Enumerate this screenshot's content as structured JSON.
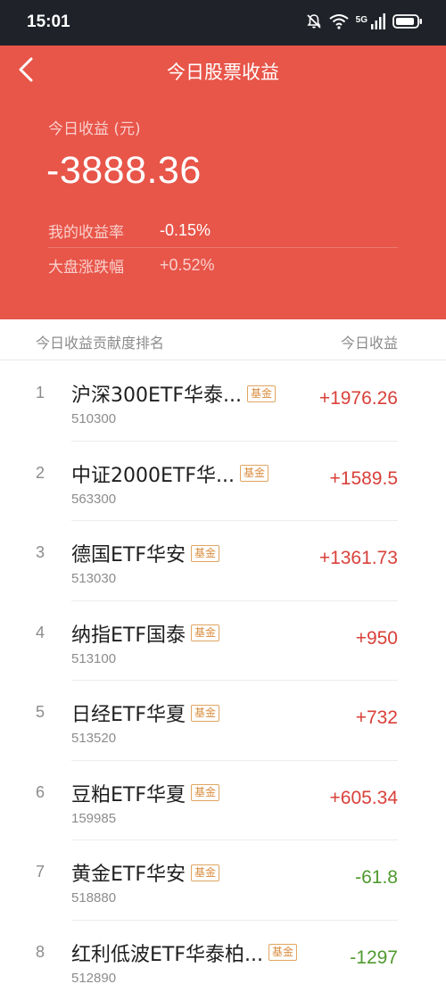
{
  "status_bar": {
    "time": "15:01",
    "network": "5G",
    "icons": [
      "mute-bell-icon",
      "wifi-icon",
      "signal-icon",
      "battery-icon"
    ]
  },
  "nav": {
    "title": "今日股票收益",
    "back_icon": "chevron-left-icon"
  },
  "summary": {
    "label": "今日收益 (元)",
    "value": "-3888.36",
    "rate_label": "我的收益率",
    "rate_value": "-0.15%",
    "market_label": "大盘涨跌幅",
    "market_value": "+0.52%"
  },
  "list_header": {
    "left": "今日收益贡献度排名",
    "right": "今日收益"
  },
  "colors": {
    "header_bg": "#e85549",
    "gain": "#d9403a",
    "loss": "#4f9a2e",
    "badge": "#d98c3e"
  },
  "items": [
    {
      "rank": "1",
      "name": "沪深300ETF华泰...",
      "badge": "基金",
      "code": "510300",
      "value": "+1976.26",
      "direction": "up"
    },
    {
      "rank": "2",
      "name": "中证2000ETF华...",
      "badge": "基金",
      "code": "563300",
      "value": "+1589.5",
      "direction": "up"
    },
    {
      "rank": "3",
      "name": "德国ETF华安",
      "badge": "基金",
      "code": "513030",
      "value": "+1361.73",
      "direction": "up"
    },
    {
      "rank": "4",
      "name": "纳指ETF国泰",
      "badge": "基金",
      "code": "513100",
      "value": "+950",
      "direction": "up"
    },
    {
      "rank": "5",
      "name": "日经ETF华夏",
      "badge": "基金",
      "code": "513520",
      "value": "+732",
      "direction": "up"
    },
    {
      "rank": "6",
      "name": "豆粕ETF华夏",
      "badge": "基金",
      "code": "159985",
      "value": "+605.34",
      "direction": "up"
    },
    {
      "rank": "7",
      "name": "黄金ETF华安",
      "badge": "基金",
      "code": "518880",
      "value": "-61.8",
      "direction": "down"
    },
    {
      "rank": "8",
      "name": "红利低波ETF华泰柏...",
      "badge": "基金",
      "code": "512890",
      "value": "-1297",
      "direction": "down"
    }
  ]
}
